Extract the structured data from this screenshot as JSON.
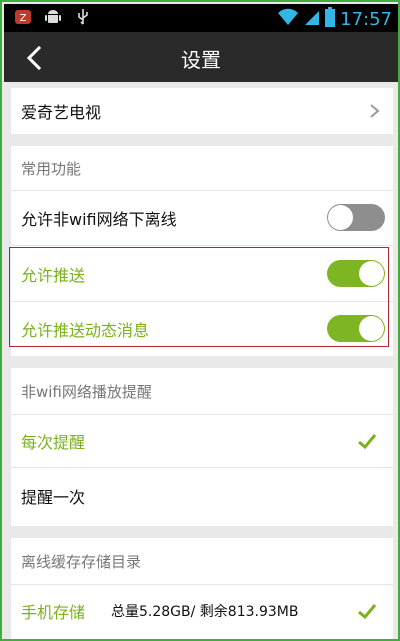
{
  "status_bar": {
    "time": "17:57",
    "icons": [
      "z-app-icon",
      "android-icon",
      "usb-icon",
      "wifi-icon",
      "signal-icon",
      "battery-icon"
    ]
  },
  "title_bar": {
    "title": "设置",
    "back_icon": "chevron-left-icon"
  },
  "sections": {
    "tv": {
      "label": "爱奇艺电视"
    },
    "common": {
      "header": "常用功能",
      "items": [
        {
          "label": "允许非wifi网络下离线",
          "toggle": "off"
        },
        {
          "label": "允许推送",
          "toggle": "on"
        },
        {
          "label": "允许推送动态消息",
          "toggle": "on"
        }
      ]
    },
    "reminder": {
      "header": "非wifi网络播放提醒",
      "options": [
        {
          "label": "每次提醒",
          "selected": true
        },
        {
          "label": "提醒一次",
          "selected": false
        }
      ]
    },
    "storage": {
      "header": "离线缓存存储目录",
      "item": {
        "label": "手机存储",
        "info": "总量5.28GB/ 剩余813.93MB",
        "selected": true
      }
    }
  },
  "colors": {
    "accent_green": "#7bb21c",
    "highlight_red": "#b3262f",
    "status_blue": "#33b5e5",
    "frame_green": "#3fae3b"
  }
}
